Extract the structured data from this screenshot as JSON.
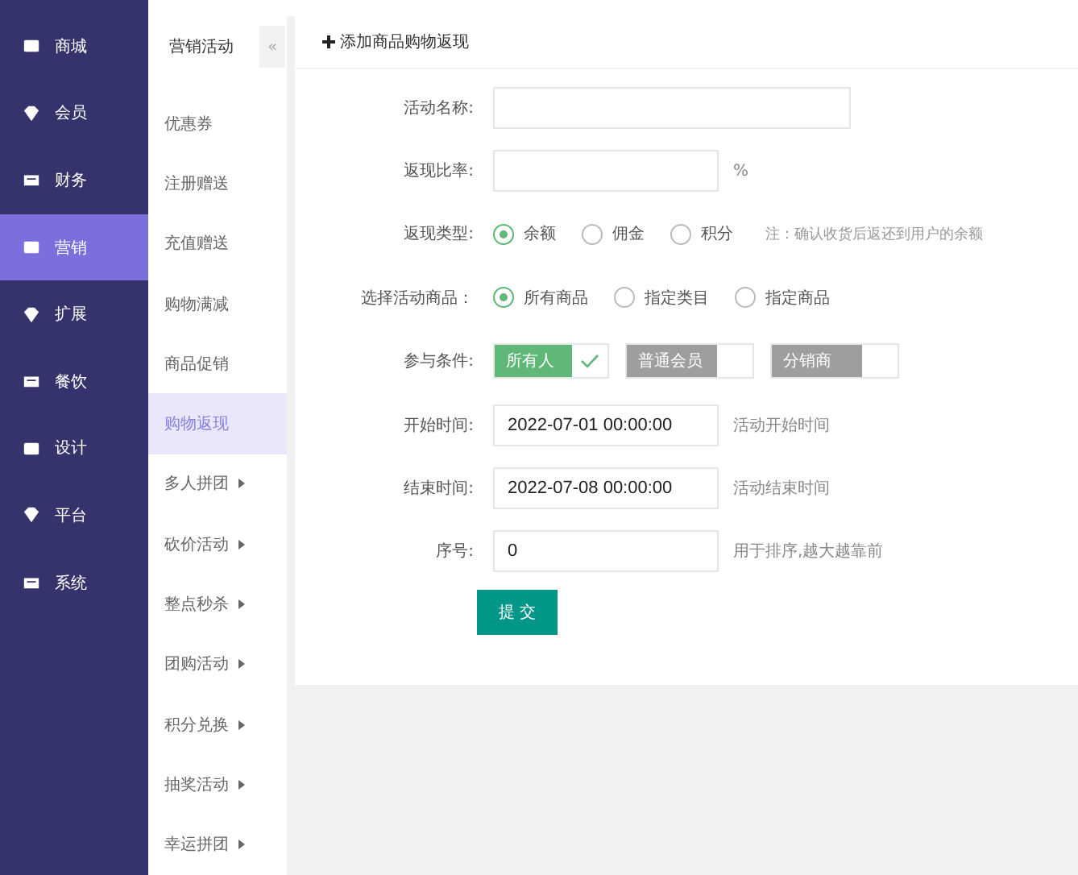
{
  "main_nav": [
    {
      "label": "商城",
      "selected": false
    },
    {
      "label": "会员",
      "selected": false
    },
    {
      "label": "财务",
      "selected": false
    },
    {
      "label": "营销",
      "selected": true
    },
    {
      "label": "扩展",
      "selected": false
    },
    {
      "label": "餐饮",
      "selected": false
    },
    {
      "label": "设计",
      "selected": false
    },
    {
      "label": "平台",
      "selected": false
    },
    {
      "label": "系统",
      "selected": false
    }
  ],
  "sub_nav": {
    "title": "营销活动",
    "collapse": "«",
    "items": [
      {
        "label": "优惠券",
        "selected": false,
        "expandable": false
      },
      {
        "label": "注册赠送",
        "selected": false,
        "expandable": false
      },
      {
        "label": "充值赠送",
        "selected": false,
        "expandable": false
      },
      {
        "label": "购物满减",
        "selected": false,
        "expandable": false
      },
      {
        "label": "商品促销",
        "selected": false,
        "expandable": false
      },
      {
        "label": "购物返现",
        "selected": true,
        "expandable": false
      },
      {
        "label": "多人拼团",
        "selected": false,
        "expandable": true
      },
      {
        "label": "砍价活动",
        "selected": false,
        "expandable": true
      },
      {
        "label": "整点秒杀",
        "selected": false,
        "expandable": true
      },
      {
        "label": "团购活动",
        "selected": false,
        "expandable": true
      },
      {
        "label": "积分兑换",
        "selected": false,
        "expandable": true
      },
      {
        "label": "抽奖活动",
        "selected": false,
        "expandable": true
      },
      {
        "label": "幸运拼团",
        "selected": false,
        "expandable": true
      }
    ]
  },
  "form": {
    "title": "添加商品购物返现",
    "rows": [
      {
        "kind": "input",
        "label": "活动名称:",
        "value": "",
        "wide": true
      },
      {
        "kind": "input",
        "label": "返现比率:",
        "value": "",
        "suffix": "%"
      },
      {
        "kind": "radio",
        "label": "返现类型:",
        "options": [
          {
            "label": "余额",
            "selected": true
          },
          {
            "label": "佣金",
            "selected": false
          },
          {
            "label": "积分",
            "selected": false
          }
        ],
        "note": "注：确认收货后返还到用户的余额"
      },
      {
        "kind": "radio",
        "label": "选择活动商品：",
        "options": [
          {
            "label": "所有商品",
            "selected": true
          },
          {
            "label": "指定类目",
            "selected": false
          },
          {
            "label": "指定商品",
            "selected": false
          }
        ]
      },
      {
        "kind": "checks",
        "label": "参与条件:",
        "options": [
          {
            "label": "所有人",
            "checked": true
          },
          {
            "label": "普通会员",
            "checked": false
          },
          {
            "label": "分销商",
            "checked": false
          }
        ]
      },
      {
        "kind": "input",
        "label": "开始时间:",
        "value": "2022-07-01 00:00:00",
        "hint": "活动开始时间"
      },
      {
        "kind": "input",
        "label": "结束时间:",
        "value": "2022-07-08 00:00:00",
        "hint": "活动结束时间"
      },
      {
        "kind": "input",
        "label": "序号:",
        "value": "0",
        "hint": "用于排序,越大越靠前"
      }
    ],
    "submit": "提 交"
  }
}
